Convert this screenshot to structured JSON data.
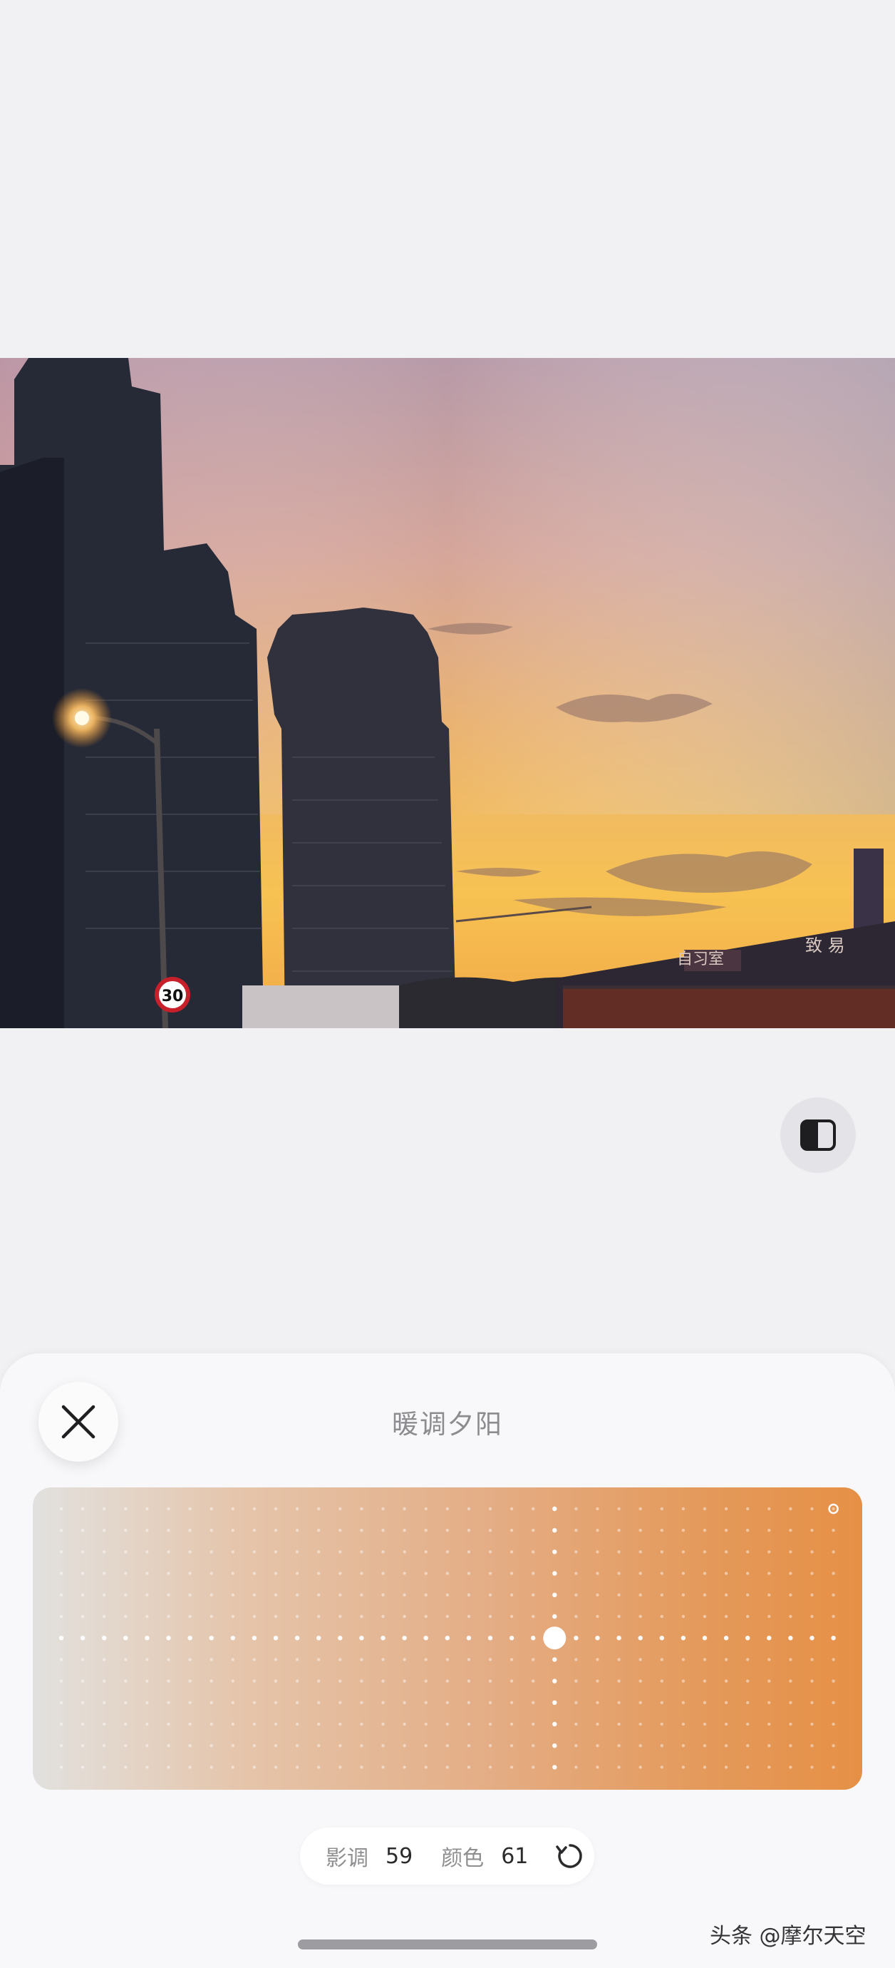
{
  "filter": {
    "title": "暖调夕阳",
    "tone_label": "影调",
    "tone_value": "59",
    "color_label": "颜色",
    "color_value": "61"
  },
  "photo": {
    "speed_sign": "30",
    "sign_text_1": "自习室",
    "sign_text_2": "致 易"
  },
  "pad": {
    "colors": {
      "left": "#e2e1df",
      "mid": "#e4ad85",
      "right": "#e69046"
    }
  },
  "watermark": "头条 @摩尔天空",
  "icons": {
    "close": "close-icon",
    "compare": "compare-icon",
    "reset": "reset-icon"
  }
}
